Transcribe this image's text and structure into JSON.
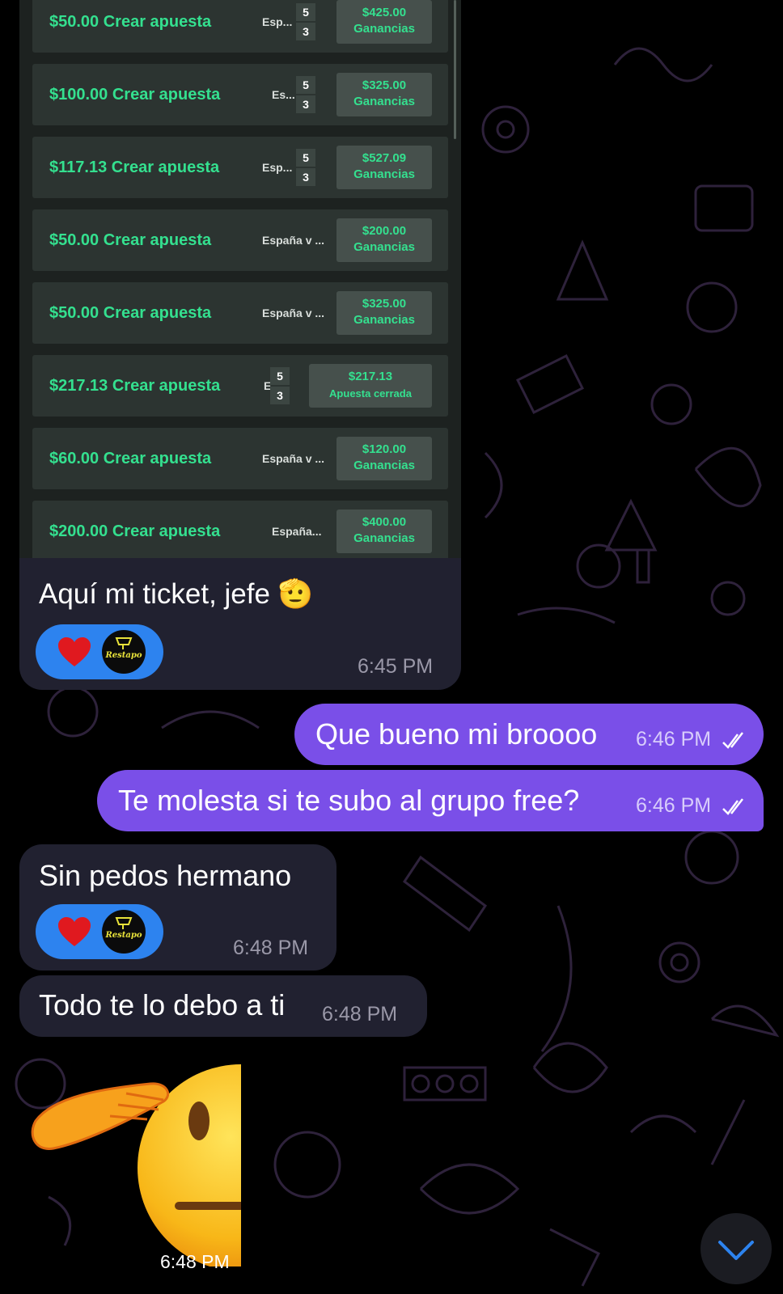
{
  "ticket": {
    "bets": [
      {
        "amount": "$50.00 Crear apuesta",
        "match": "Esp...",
        "score_home": "5",
        "score_away": "3",
        "payout": "$425.00",
        "status": "Ganancias"
      },
      {
        "amount": "$100.00 Crear apuesta",
        "match": "Es...",
        "score_home": "5",
        "score_away": "3",
        "payout": "$325.00",
        "status": "Ganancias"
      },
      {
        "amount": "$117.13 Crear apuesta",
        "match": "Esp...",
        "score_home": "5",
        "score_away": "3",
        "payout": "$527.09",
        "status": "Ganancias"
      },
      {
        "amount": "$50.00 Crear apuesta",
        "match": "España v ...",
        "score_home": "",
        "score_away": "",
        "payout": "$200.00",
        "status": "Ganancias"
      },
      {
        "amount": "$50.00 Crear apuesta",
        "match": "España v ...",
        "score_home": "",
        "score_away": "",
        "payout": "$325.00",
        "status": "Ganancias"
      },
      {
        "amount": "$217.13 Crear apuesta",
        "match": "E",
        "score_home": "5",
        "score_away": "3",
        "payout": "$217.13",
        "status": "Apuesta cerrada"
      },
      {
        "amount": "$60.00 Crear apuesta",
        "match": "España v ...",
        "score_home": "",
        "score_away": "",
        "payout": "$120.00",
        "status": "Ganancias"
      },
      {
        "amount": "$200.00 Crear apuesta",
        "match": "España...",
        "score_home": "",
        "score_away": "",
        "payout": "$400.00",
        "status": "Ganancias"
      }
    ],
    "caption": "Aquí mi ticket, jefe 🫡",
    "time": "6:45 PM"
  },
  "reaction": {
    "avatar_text": "Restapo"
  },
  "messages": [
    {
      "text": "Que bueno mi broooo",
      "time": "6:46 PM"
    },
    {
      "text": "Te molesta si te subo al grupo free?",
      "time": "6:46 PM"
    },
    {
      "text": "Sin pedos hermano",
      "time": "6:48 PM"
    },
    {
      "text": "Todo te lo debo a ti",
      "time": "6:48 PM"
    }
  ],
  "sticker": {
    "name": "saluting-face",
    "time": "6:48 PM"
  },
  "colors": {
    "outgoing": "#7a4fe8",
    "incoming": "#212130",
    "reaction": "#2d83ef",
    "green": "#34e08f"
  },
  "icons": [
    "heart-icon",
    "double-check-icon",
    "chevron-down-icon"
  ]
}
